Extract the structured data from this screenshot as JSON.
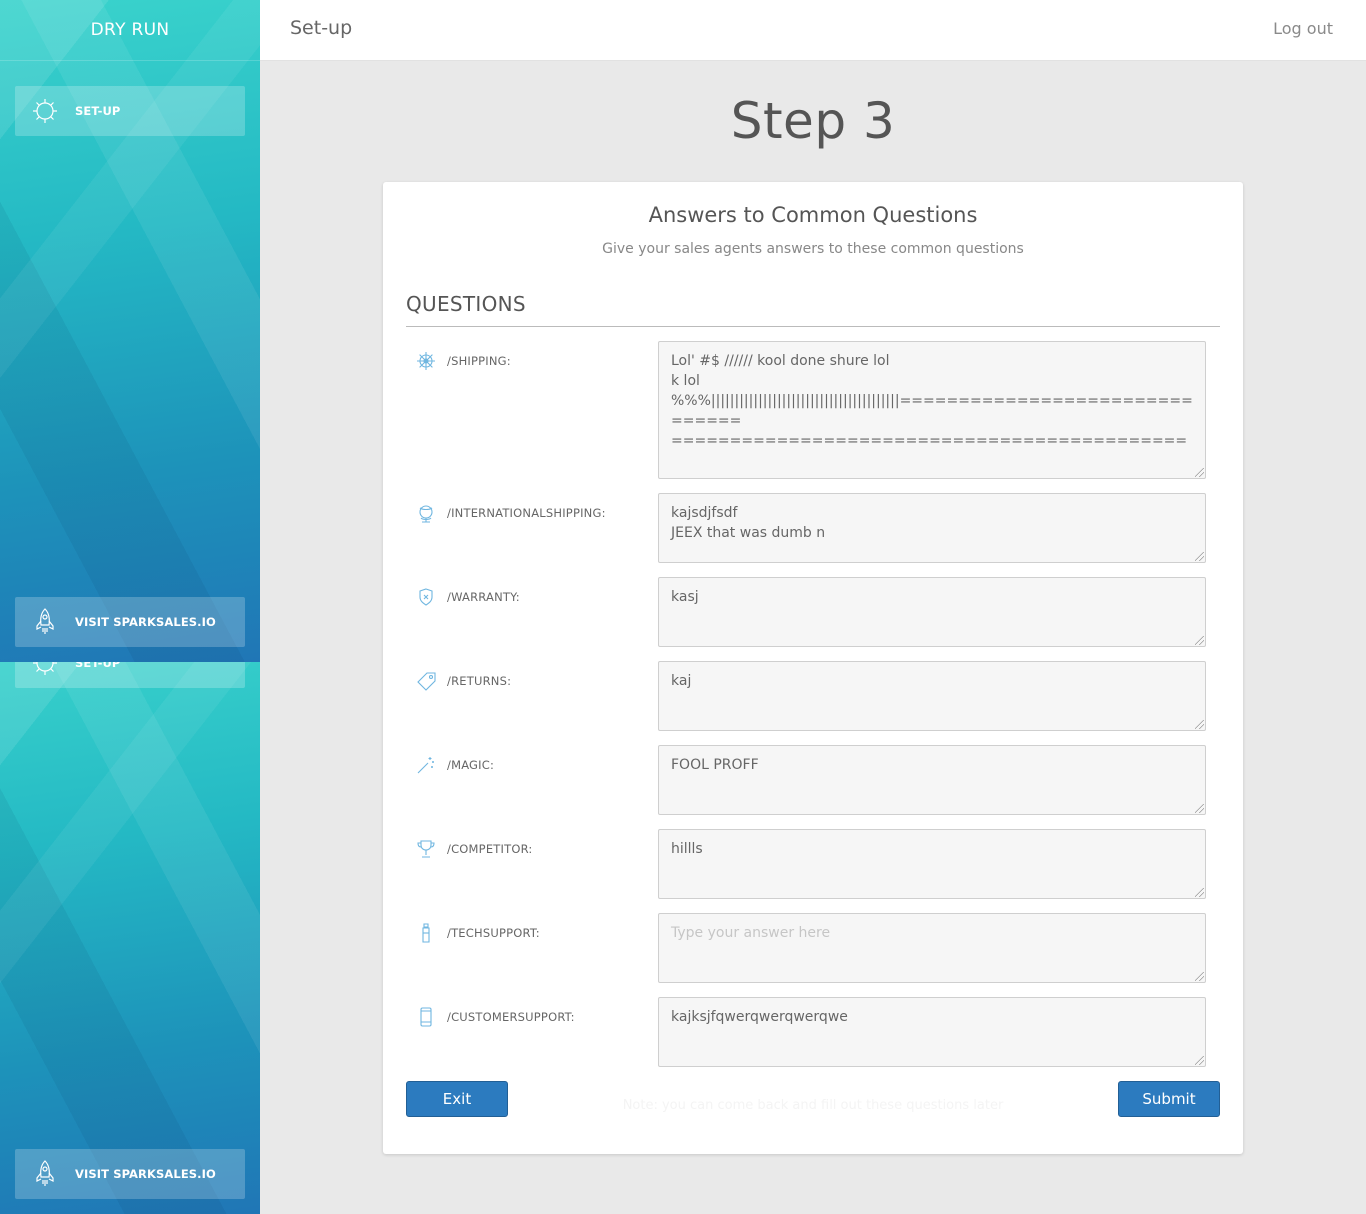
{
  "sidebar": {
    "brand": "DRY RUN",
    "setup_label": "SET-UP",
    "visit_label": "VISIT SPARKSALES.IO"
  },
  "header": {
    "title": "Set-up",
    "logout": "Log out"
  },
  "step_title": "Step 3",
  "card": {
    "title": "Answers to Common Questions",
    "subtitle": "Give your sales agents answers to these common questions",
    "section": "QUESTIONS",
    "questions": [
      {
        "label": "/SHIPPING:",
        "icon": "ship-wheel-icon",
        "value": "Lol' #$ ////// kool done shure lol\nk lol\n%%%||||||||||||||||||||||||||||||||||||||||===============================\n============================================"
      },
      {
        "label": "/INTERNATIONALSHIPPING:",
        "icon": "globe-icon",
        "value": "kajsdjfsdf\nJEEX that was dumb n"
      },
      {
        "label": "/WARRANTY:",
        "icon": "shield-icon",
        "value": "kasj"
      },
      {
        "label": "/RETURNS:",
        "icon": "tag-icon",
        "value": "kaj"
      },
      {
        "label": "/MAGIC:",
        "icon": "magic-wand-icon",
        "value": "FOOL PROFF"
      },
      {
        "label": "/COMPETITOR:",
        "icon": "trophy-icon",
        "value": "hillls"
      },
      {
        "label": "/TECHSUPPORT:",
        "icon": "bottle-icon",
        "value": "",
        "placeholder": "Type your answer here"
      },
      {
        "label": "/CUSTOMERSUPPORT:",
        "icon": "phone-icon",
        "value": "kajksjfqwerqwerqwerqwe"
      }
    ],
    "exit_label": "Exit",
    "submit_label": "Submit",
    "note": "Note: you can come back and fill out these questions later"
  }
}
